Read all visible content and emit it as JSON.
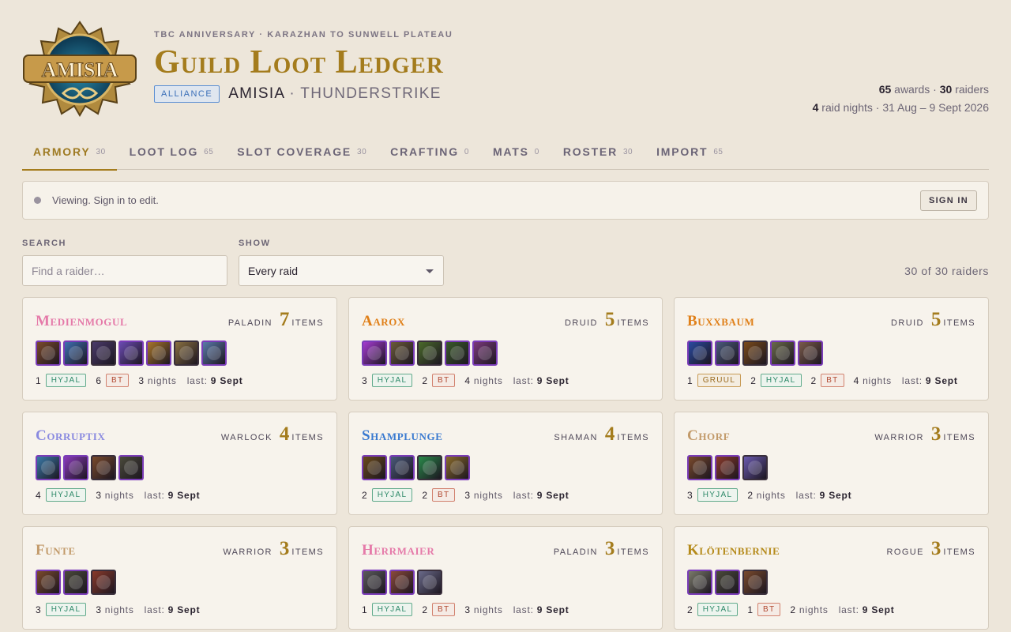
{
  "header": {
    "eyebrow": "TBC ANNIVERSARY · KARAZHAN TO SUNWELL PLATEAU",
    "title": "Guild Loot Ledger",
    "faction": "ALLIANCE",
    "guild": "AMISIA",
    "realm": "· THUNDERSTRIKE",
    "logo_text": "AMISIA"
  },
  "stats": {
    "awards": "65",
    "awards_label": "awards ·",
    "raiders": "30",
    "raiders_label": "raiders",
    "nights": "4",
    "nights_label": "raid nights · 31 Aug – 9 Sept 2026"
  },
  "tabs": [
    {
      "label": "ARMORY",
      "count": "30"
    },
    {
      "label": "LOOT LOG",
      "count": "65"
    },
    {
      "label": "SLOT COVERAGE",
      "count": "30"
    },
    {
      "label": "CRAFTING",
      "count": "0"
    },
    {
      "label": "MATS",
      "count": "0"
    },
    {
      "label": "ROSTER",
      "count": "30"
    },
    {
      "label": "IMPORT",
      "count": "65"
    }
  ],
  "notice": {
    "text": "Viewing. Sign in to edit.",
    "button": "SIGN IN"
  },
  "filters": {
    "search_label": "SEARCH",
    "search_placeholder": "Find a raider…",
    "show_label": "SHOW",
    "show_value": "Every raid",
    "counter": "30 of 30 raiders"
  },
  "items_label": "ITEMS",
  "nights_word": "nights",
  "last_word": "last:",
  "raiders": [
    {
      "name": "Medienmogul",
      "class": "PALADIN",
      "count": "7",
      "color": "#e57aa9",
      "icons": [
        "#7a4a2c",
        "#3e6fb0",
        "#4a3a6a",
        "#6a4ab0",
        "#a8762a",
        "#8a7040",
        "#5a7aa8"
      ],
      "loot": [
        {
          "n": "1",
          "raid": "HYJAL"
        },
        {
          "n": "6",
          "raid": "BT"
        }
      ],
      "nights": "3",
      "last": "9 Sept"
    },
    {
      "name": "Aarox",
      "class": "DRUID",
      "count": "5",
      "color": "#e0801a",
      "icons": [
        "#a53ad0",
        "#6a5a3a",
        "#4a6a2a",
        "#3a5a2a",
        "#7a3a7a"
      ],
      "loot": [
        {
          "n": "3",
          "raid": "HYJAL"
        },
        {
          "n": "2",
          "raid": "BT"
        }
      ],
      "nights": "4",
      "last": "9 Sept"
    },
    {
      "name": "Buxxbaum",
      "class": "DRUID",
      "count": "5",
      "color": "#e0801a",
      "icons": [
        "#2a4aa0",
        "#4a5a7a",
        "#7a4a1a",
        "#6a6a4a",
        "#7a5a4a"
      ],
      "loot": [
        {
          "n": "1",
          "raid": "GRUUL"
        },
        {
          "n": "2",
          "raid": "HYJAL"
        },
        {
          "n": "2",
          "raid": "BT"
        }
      ],
      "nights": "4",
      "last": "9 Sept"
    },
    {
      "name": "Corruptix",
      "class": "WARLOCK",
      "count": "4",
      "color": "#8a8ae0",
      "icons": [
        "#3a7aa8",
        "#8a3ab8",
        "#7a4a2c",
        "#4a4a3a"
      ],
      "loot": [
        {
          "n": "4",
          "raid": "HYJAL"
        }
      ],
      "nights": "3",
      "last": "9 Sept"
    },
    {
      "name": "Shamplunge",
      "class": "SHAMAN",
      "count": "4",
      "color": "#3a7ad0",
      "icons": [
        "#6a4a1a",
        "#4a5a7a",
        "#2a8a4a",
        "#8a6a2a"
      ],
      "loot": [
        {
          "n": "2",
          "raid": "HYJAL"
        },
        {
          "n": "2",
          "raid": "BT"
        }
      ],
      "nights": "3",
      "last": "9 Sept"
    },
    {
      "name": "Chorf",
      "class": "WARRIOR",
      "count": "3",
      "color": "#c29a6a",
      "icons": [
        "#7a4a2c",
        "#8a3a2a",
        "#6a5ab0"
      ],
      "loot": [
        {
          "n": "3",
          "raid": "HYJAL"
        }
      ],
      "nights": "2",
      "last": "9 Sept"
    },
    {
      "name": "Funte",
      "class": "WARRIOR",
      "count": "3",
      "color": "#c29a6a",
      "icons": [
        "#7a4a2c",
        "#4a4a3a",
        "#8a3a2a"
      ],
      "loot": [
        {
          "n": "3",
          "raid": "HYJAL"
        }
      ],
      "nights": "3",
      "last": "9 Sept"
    },
    {
      "name": "Herrmaier",
      "class": "PALADIN",
      "count": "3",
      "color": "#e57aa9",
      "icons": [
        "#5a5a5a",
        "#8a4a3a",
        "#6a6a8a"
      ],
      "loot": [
        {
          "n": "1",
          "raid": "HYJAL"
        },
        {
          "n": "2",
          "raid": "BT"
        }
      ],
      "nights": "3",
      "last": "9 Sept"
    },
    {
      "name": "Klötenbernie",
      "class": "ROGUE",
      "count": "3",
      "color": "#b58a1a",
      "icons": [
        "#7a7a6a",
        "#4a4a3a",
        "#7a4a2c"
      ],
      "loot": [
        {
          "n": "2",
          "raid": "HYJAL"
        },
        {
          "n": "1",
          "raid": "BT"
        }
      ],
      "nights": "2",
      "last": "9 Sept"
    }
  ]
}
